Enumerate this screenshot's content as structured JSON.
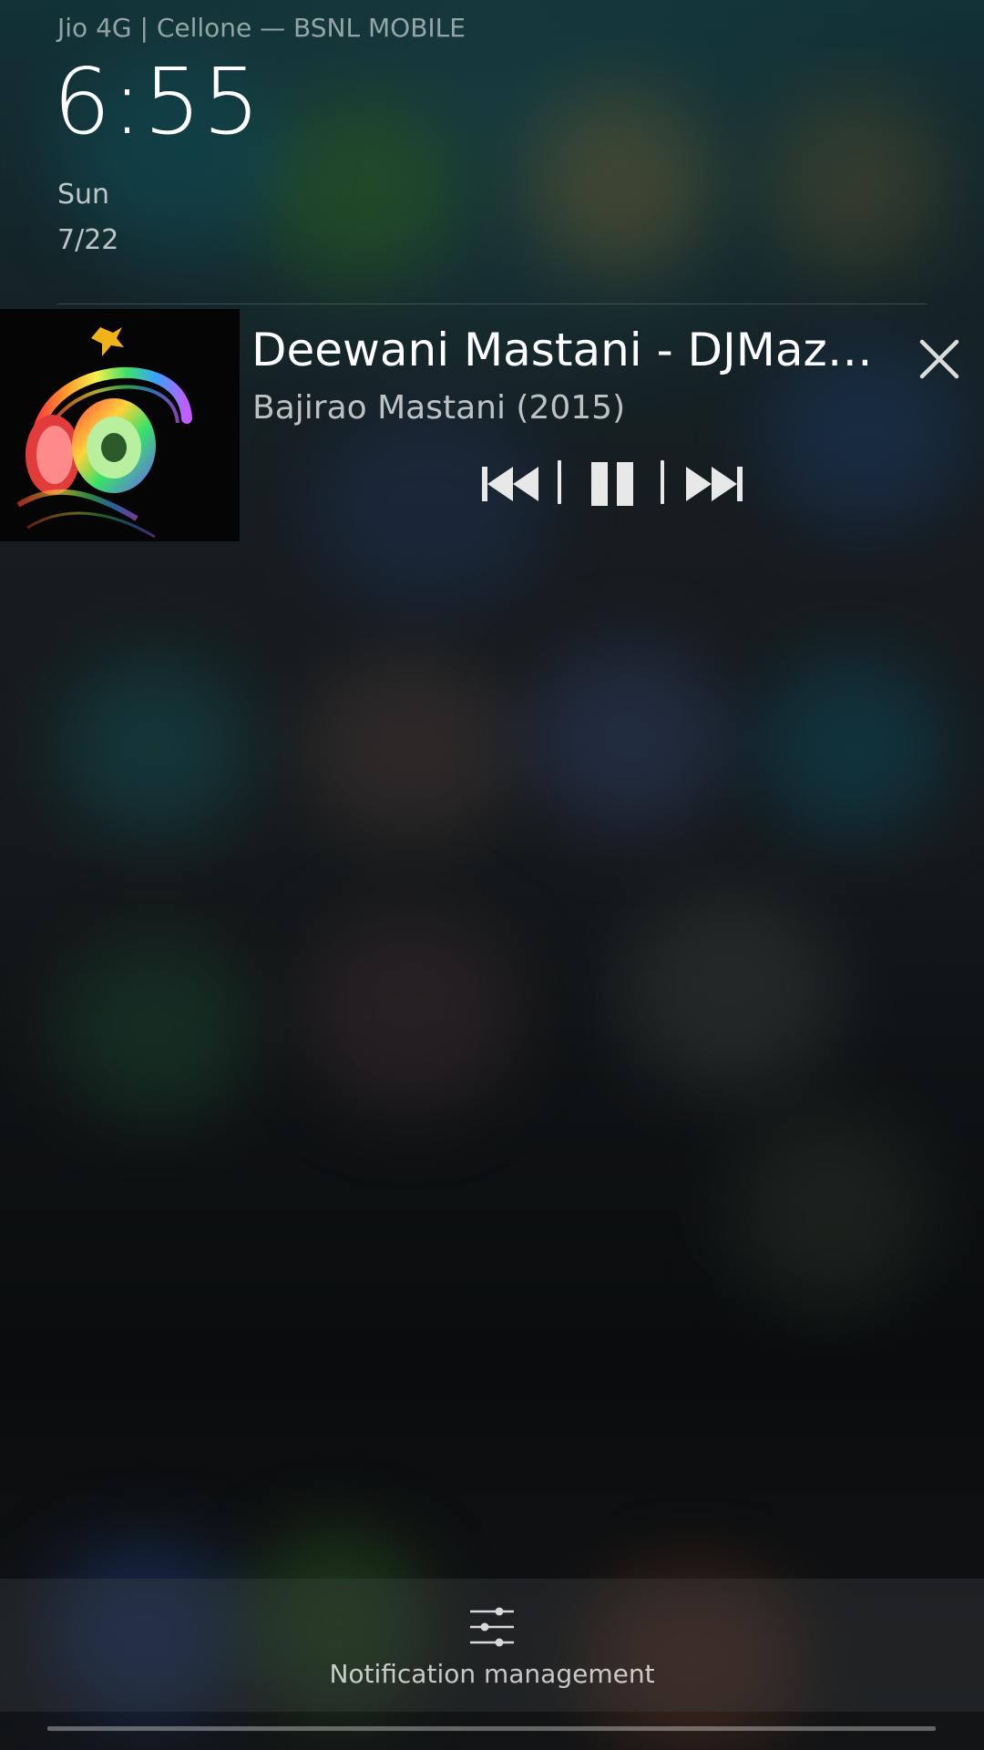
{
  "status": {
    "carrier_text": "Jio 4G | Cellone — BSNL MOBILE"
  },
  "lockscreen": {
    "time": "6:55",
    "day": "Sun",
    "date": "7/22"
  },
  "media_notification": {
    "title": "Deewani Mastani - DJMaza.I…",
    "album": "Bajirao Mastani (2015)",
    "album_art": "rainbow-headphones-artwork",
    "controls": {
      "previous": "previous-icon",
      "pause": "pause-icon",
      "next": "next-icon",
      "close": "close-icon"
    }
  },
  "bottom_bar": {
    "label": "Notification management",
    "icon": "sliders-icon"
  },
  "colors": {
    "text_primary": "#ffffff",
    "text_secondary": "#b8b8b8",
    "control_icon": "#e8e8e8"
  }
}
